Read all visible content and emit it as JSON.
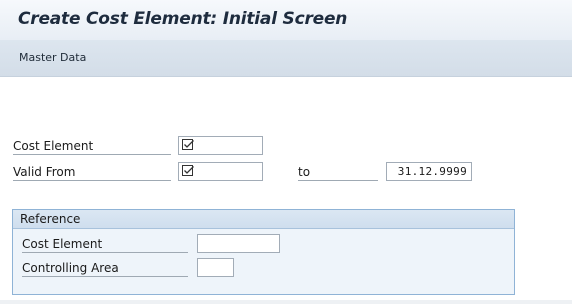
{
  "window": {
    "title": "Create Cost Element: Initial Screen"
  },
  "toolbar": {
    "master_data_label": "Master Data"
  },
  "form": {
    "cost_element": {
      "label": "Cost Element",
      "value": ""
    },
    "valid_from": {
      "label": "Valid From",
      "value": ""
    },
    "valid_to": {
      "label": "to",
      "value": "31.12.9999"
    },
    "required_icon": "required-entry-checkbox-icon"
  },
  "reference": {
    "title": "Reference",
    "cost_element": {
      "label": "Cost Element",
      "value": ""
    },
    "controlling_area": {
      "label": "Controlling Area",
      "value": ""
    }
  },
  "colors": {
    "title_text": "#1e2c3e",
    "toolbar_bg": "#d3dde8",
    "group_border": "#8fb3d6",
    "group_bg": "#eef4fa"
  }
}
